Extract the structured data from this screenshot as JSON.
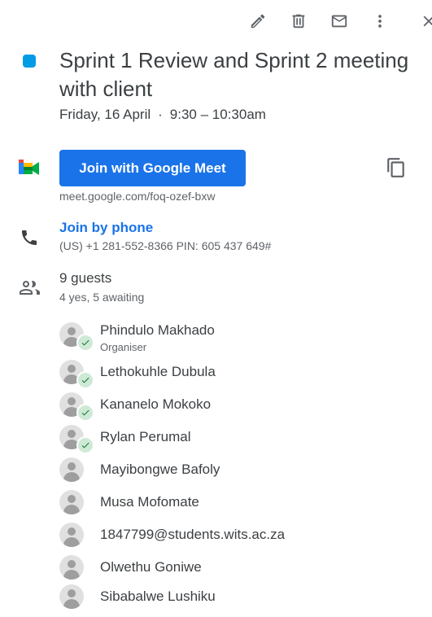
{
  "toolbar": {
    "icons": [
      "edit-icon",
      "delete-icon",
      "email-icon",
      "more-vert-icon",
      "close-icon"
    ]
  },
  "event": {
    "color": "#039be5",
    "title": "Sprint 1 Review and Sprint 2 meeting with client",
    "date": "Friday, 16 April",
    "separator": "·",
    "time": "9:30 – 10:30am"
  },
  "meet": {
    "button_label": "Join with Google Meet",
    "link": "meet.google.com/foq-ozef-bxw"
  },
  "phone": {
    "label": "Join by phone",
    "details": "(US) +1 281-552-8366 PIN: 605 437 649#"
  },
  "guests": {
    "count_label": "9 guests",
    "summary": "4 yes, 5 awaiting",
    "list": [
      {
        "name": "Phindulo Makhado",
        "role": "Organiser",
        "accepted": true
      },
      {
        "name": "Lethokuhle Dubula",
        "role": "",
        "accepted": true
      },
      {
        "name": "Kananelo Mokoko",
        "role": "",
        "accepted": true
      },
      {
        "name": "Rylan Perumal",
        "role": "",
        "accepted": true
      },
      {
        "name": "Mayibongwe Bafoly",
        "role": "",
        "accepted": false
      },
      {
        "name": "Musa Mofomate",
        "role": "",
        "accepted": false
      },
      {
        "name": "1847799@students.wits.ac.za",
        "role": "",
        "accepted": false
      },
      {
        "name": "Olwethu Goniwe",
        "role": "",
        "accepted": false
      },
      {
        "name": "Sibabalwe Lushiku",
        "role": "",
        "accepted": false
      }
    ]
  },
  "colors": {
    "primary": "#1a73e8",
    "accepted": "#137333"
  }
}
